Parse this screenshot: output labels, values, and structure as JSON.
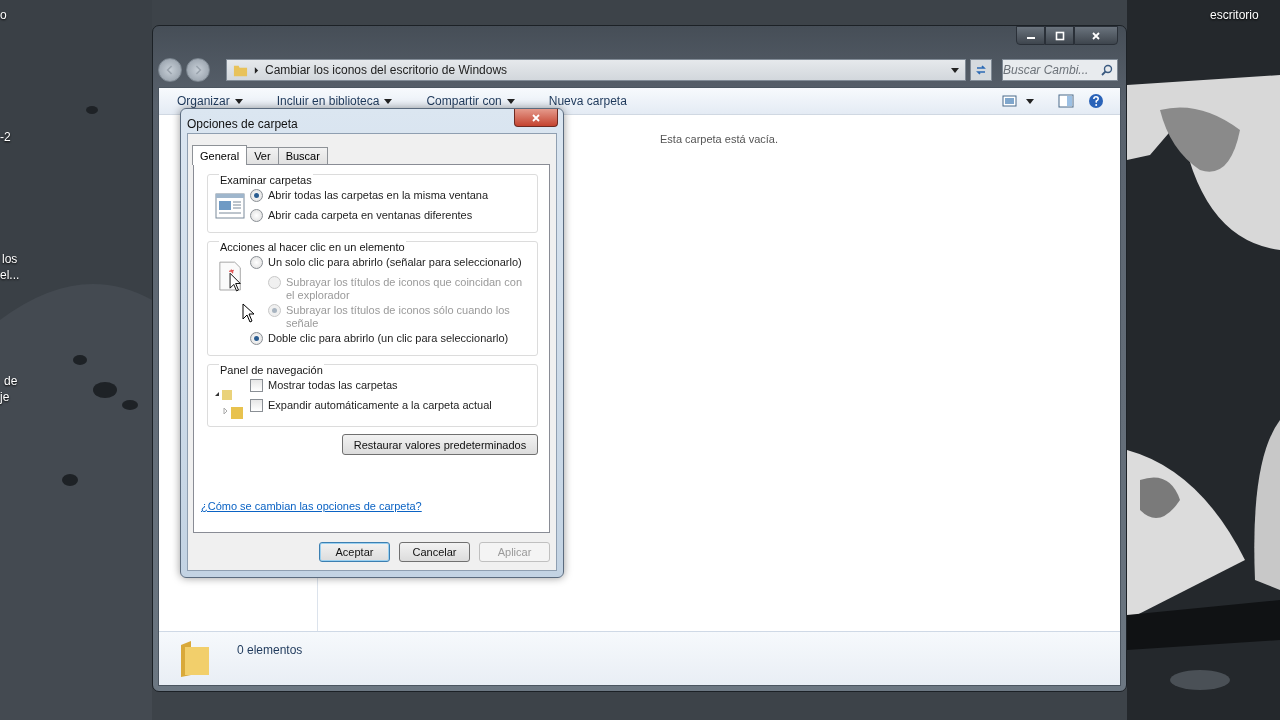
{
  "desktop": {
    "left_labels": [
      {
        "label": "o"
      },
      {
        "label": "-2"
      },
      {
        "label": "los"
      },
      {
        "label": "el..."
      },
      {
        "label": "de"
      },
      {
        "label": "je"
      }
    ],
    "right_labels": [
      {
        "label": "escritorio"
      }
    ]
  },
  "explorer": {
    "address": "Cambiar los iconos del escritorio de Windows",
    "search": {
      "placeholder": "Buscar Cambi..."
    },
    "toolbar": [
      {
        "label": "Organizar",
        "dropdown": true
      },
      {
        "label": "Incluir en biblioteca",
        "dropdown": true
      },
      {
        "label": "Compartir con",
        "dropdown": true
      },
      {
        "label": "Nueva carpeta",
        "dropdown": false
      }
    ],
    "empty_message": "Esta carpeta está vacía.",
    "status": "0 elementos"
  },
  "dialog": {
    "title": "Opciones de carpeta",
    "tabs": [
      {
        "label": "General",
        "selected": true
      },
      {
        "label": "Ver",
        "selected": false
      },
      {
        "label": "Buscar",
        "selected": false
      }
    ],
    "groups": [
      {
        "title": "Examinar carpetas",
        "options": [
          {
            "kind": "radio",
            "label": "Abrir todas las carpetas en la misma ventana",
            "selected": true,
            "disabled": false
          },
          {
            "kind": "radio",
            "label": "Abrir cada carpeta en ventanas diferentes",
            "selected": false,
            "disabled": false
          }
        ]
      },
      {
        "title": "Acciones al hacer clic en un elemento",
        "options": [
          {
            "kind": "radio",
            "label": "Un solo clic para abrirlo (señalar para seleccionarlo)",
            "selected": false,
            "disabled": false,
            "children": [
              {
                "kind": "radio",
                "label": "Subrayar los títulos de iconos que coincidan con el explorador",
                "selected": false,
                "disabled": true
              },
              {
                "kind": "radio",
                "label": "Subrayar los títulos de iconos sólo cuando los señale",
                "selected": true,
                "disabled": true
              }
            ]
          },
          {
            "kind": "radio",
            "label": "Doble clic para abrirlo (un clic para seleccionarlo)",
            "selected": true,
            "disabled": false
          }
        ]
      },
      {
        "title": "Panel de navegación",
        "options": [
          {
            "kind": "checkbox",
            "label": "Mostrar todas las carpetas",
            "checked": false
          },
          {
            "kind": "checkbox",
            "label": "Expandir automáticamente a la carpeta actual",
            "checked": false
          }
        ]
      }
    ],
    "restore_button": "Restaurar valores predeterminados",
    "help_link": "¿Cómo se cambian las opciones de carpeta?",
    "buttons": [
      {
        "label": "Aceptar",
        "default": true,
        "disabled": false
      },
      {
        "label": "Cancelar",
        "default": false,
        "disabled": false
      },
      {
        "label": "Aplicar",
        "default": false,
        "disabled": true
      }
    ]
  }
}
